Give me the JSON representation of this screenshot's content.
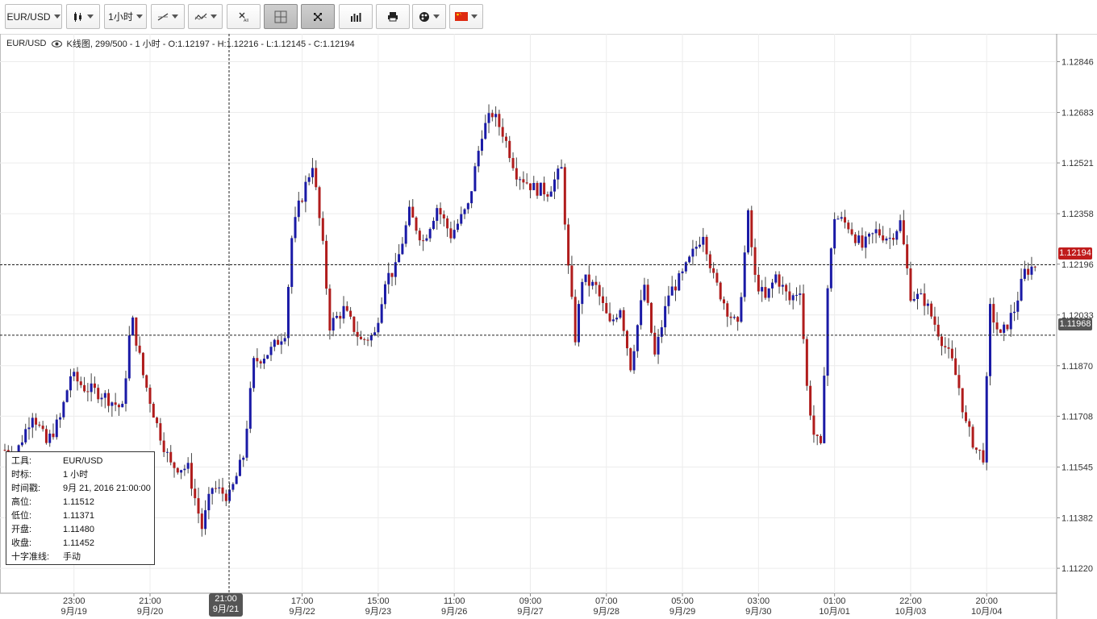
{
  "toolbar": {
    "instrument": "EUR/USD",
    "timeframe": "1小时",
    "items": [
      {
        "name": "instrument-select-button",
        "label": "EUR/USD"
      },
      {
        "name": "chart-type-button",
        "icon": "candlestick-icon"
      },
      {
        "name": "timeframe-select-button",
        "label": "1小时"
      },
      {
        "name": "drawing-tools-button",
        "icon": "line-tool-icon"
      },
      {
        "name": "indicators-button",
        "icon": "indicator-icon"
      },
      {
        "name": "delete-all-button",
        "icon": "delete-all-icon"
      },
      {
        "name": "crosshair-toggle-button",
        "icon": "crosshair-icon"
      },
      {
        "name": "fullscreen-button",
        "icon": "fullscreen-icon"
      },
      {
        "name": "volume-button",
        "icon": "bar-chart-icon"
      },
      {
        "name": "print-button",
        "icon": "printer-icon"
      },
      {
        "name": "settings-button",
        "icon": "palette-icon"
      },
      {
        "name": "language-button",
        "icon": "china-flag-icon"
      }
    ]
  },
  "info_bar": {
    "symbol": "EUR/USD",
    "eye_icon": "eye-icon",
    "details": "K线图, 299/500 - 1 小时 - O:1.12197 - H:1.12216 - L:1.12145 - C:1.12194"
  },
  "tooltip": {
    "rows": [
      {
        "k": "工具:",
        "v": "EUR/USD"
      },
      {
        "k": "时标:",
        "v": "1 小时"
      },
      {
        "k": "时间戳:",
        "v": "9月 21, 2016 21:00:00"
      },
      {
        "k": "高位:",
        "v": "1.11512"
      },
      {
        "k": "低位:",
        "v": "1.11371"
      },
      {
        "k": "开盘:",
        "v": "1.11480"
      },
      {
        "k": "收盘:",
        "v": "1.11452"
      },
      {
        "k": "十字准线:",
        "v": "手动"
      }
    ]
  },
  "price_tags": {
    "last": "1.12194",
    "crosshair": "1.11968"
  },
  "time_tag": {
    "time": "21:00",
    "date": "9月/21"
  },
  "colors": {
    "up": "#1a1aa6",
    "down": "#b01c1c",
    "grid": "#ececec",
    "last_tag": "#c01c1c",
    "crosshair_tag": "#555555"
  },
  "chart_data": {
    "type": "candlestick",
    "y_ticks": [
      "1.12846",
      "1.12683",
      "1.12521",
      "1.12358",
      "1.12196",
      "1.12033",
      "1.11870",
      "1.11708",
      "1.11545",
      "1.11382",
      "1.11220"
    ],
    "y_tick_values": [
      1.12846,
      1.12683,
      1.12521,
      1.12358,
      1.12196,
      1.12033,
      1.1187,
      1.11708,
      1.11545,
      1.11382,
      1.1122
    ],
    "ylim": [
      1.1114,
      1.1293
    ],
    "x_ticks": [
      {
        "time": "23:00",
        "date": "9月/19",
        "index": 20
      },
      {
        "time": "21:00",
        "date": "9月/20",
        "index": 42
      },
      {
        "time": "17:00",
        "date": "9月/22",
        "index": 86
      },
      {
        "time": "15:00",
        "date": "9月/23",
        "index": 108
      },
      {
        "time": "11:00",
        "date": "9月/26",
        "index": 130
      },
      {
        "time": "09:00",
        "date": "9月/27",
        "index": 152
      },
      {
        "time": "07:00",
        "date": "9月/28",
        "index": 174
      },
      {
        "time": "05:00",
        "date": "9月/29",
        "index": 196
      },
      {
        "time": "03:00",
        "date": "9月/30",
        "index": 218
      },
      {
        "time": "01:00",
        "date": "10月/01",
        "index": 240
      },
      {
        "time": "22:00",
        "date": "10月/03",
        "index": 262
      },
      {
        "time": "20:00",
        "date": "10月/04",
        "index": 284
      }
    ],
    "last_price": 1.12194,
    "crosshair_price": 1.11968,
    "crosshair_index": 65,
    "anchors": [
      {
        "i": 0,
        "p": 1.116
      },
      {
        "i": 3,
        "p": 1.1158
      },
      {
        "i": 8,
        "p": 1.1172
      },
      {
        "i": 12,
        "p": 1.1162
      },
      {
        "i": 16,
        "p": 1.117
      },
      {
        "i": 19,
        "p": 1.1184
      },
      {
        "i": 23,
        "p": 1.118
      },
      {
        "i": 28,
        "p": 1.1178
      },
      {
        "i": 34,
        "p": 1.1173
      },
      {
        "i": 36,
        "p": 1.1196
      },
      {
        "i": 37,
        "p": 1.1201
      },
      {
        "i": 40,
        "p": 1.1184
      },
      {
        "i": 44,
        "p": 1.1168
      },
      {
        "i": 48,
        "p": 1.1155
      },
      {
        "i": 53,
        "p": 1.1154
      },
      {
        "i": 57,
        "p": 1.1135
      },
      {
        "i": 60,
        "p": 1.1148
      },
      {
        "i": 65,
        "p": 1.1145
      },
      {
        "i": 69,
        "p": 1.1158
      },
      {
        "i": 72,
        "p": 1.1188
      },
      {
        "i": 77,
        "p": 1.1192
      },
      {
        "i": 81,
        "p": 1.1198
      },
      {
        "i": 83,
        "p": 1.1228
      },
      {
        "i": 85,
        "p": 1.1238
      },
      {
        "i": 89,
        "p": 1.1252
      },
      {
        "i": 92,
        "p": 1.1225
      },
      {
        "i": 94,
        "p": 1.12
      },
      {
        "i": 98,
        "p": 1.1205
      },
      {
        "i": 103,
        "p": 1.1195
      },
      {
        "i": 107,
        "p": 1.1197
      },
      {
        "i": 110,
        "p": 1.1215
      },
      {
        "i": 113,
        "p": 1.1218
      },
      {
        "i": 117,
        "p": 1.1236
      },
      {
        "i": 121,
        "p": 1.1227
      },
      {
        "i": 125,
        "p": 1.1238
      },
      {
        "i": 129,
        "p": 1.1229
      },
      {
        "i": 134,
        "p": 1.1238
      },
      {
        "i": 138,
        "p": 1.1262
      },
      {
        "i": 141,
        "p": 1.1268
      },
      {
        "i": 144,
        "p": 1.1262
      },
      {
        "i": 148,
        "p": 1.1249
      },
      {
        "i": 153,
        "p": 1.1244
      },
      {
        "i": 157,
        "p": 1.1243
      },
      {
        "i": 161,
        "p": 1.125
      },
      {
        "i": 163,
        "p": 1.1218
      },
      {
        "i": 165,
        "p": 1.1196
      },
      {
        "i": 167,
        "p": 1.1215
      },
      {
        "i": 171,
        "p": 1.1212
      },
      {
        "i": 175,
        "p": 1.12
      },
      {
        "i": 178,
        "p": 1.1206
      },
      {
        "i": 181,
        "p": 1.1187
      },
      {
        "i": 185,
        "p": 1.1213
      },
      {
        "i": 188,
        "p": 1.119
      },
      {
        "i": 192,
        "p": 1.121
      },
      {
        "i": 196,
        "p": 1.1216
      },
      {
        "i": 199,
        "p": 1.1223
      },
      {
        "i": 202,
        "p": 1.123
      },
      {
        "i": 205,
        "p": 1.1215
      },
      {
        "i": 209,
        "p": 1.1205
      },
      {
        "i": 212,
        "p": 1.1199
      },
      {
        "i": 215,
        "p": 1.1235
      },
      {
        "i": 217,
        "p": 1.1215
      },
      {
        "i": 220,
        "p": 1.1208
      },
      {
        "i": 223,
        "p": 1.1216
      },
      {
        "i": 227,
        "p": 1.1208
      },
      {
        "i": 230,
        "p": 1.1212
      },
      {
        "i": 232,
        "p": 1.118
      },
      {
        "i": 234,
        "p": 1.1165
      },
      {
        "i": 236,
        "p": 1.116
      },
      {
        "i": 238,
        "p": 1.1212
      },
      {
        "i": 240,
        "p": 1.1235
      },
      {
        "i": 244,
        "p": 1.1232
      },
      {
        "i": 248,
        "p": 1.1225
      },
      {
        "i": 252,
        "p": 1.123
      },
      {
        "i": 256,
        "p": 1.1228
      },
      {
        "i": 259,
        "p": 1.1233
      },
      {
        "i": 262,
        "p": 1.121
      },
      {
        "i": 266,
        "p": 1.1208
      },
      {
        "i": 270,
        "p": 1.1198
      },
      {
        "i": 274,
        "p": 1.1188
      },
      {
        "i": 276,
        "p": 1.118
      },
      {
        "i": 278,
        "p": 1.1168
      },
      {
        "i": 281,
        "p": 1.116
      },
      {
        "i": 283,
        "p": 1.1158
      },
      {
        "i": 285,
        "p": 1.1205
      },
      {
        "i": 288,
        "p": 1.1196
      },
      {
        "i": 292,
        "p": 1.1205
      },
      {
        "i": 295,
        "p": 1.1217
      },
      {
        "i": 298,
        "p": 1.12194
      }
    ]
  }
}
